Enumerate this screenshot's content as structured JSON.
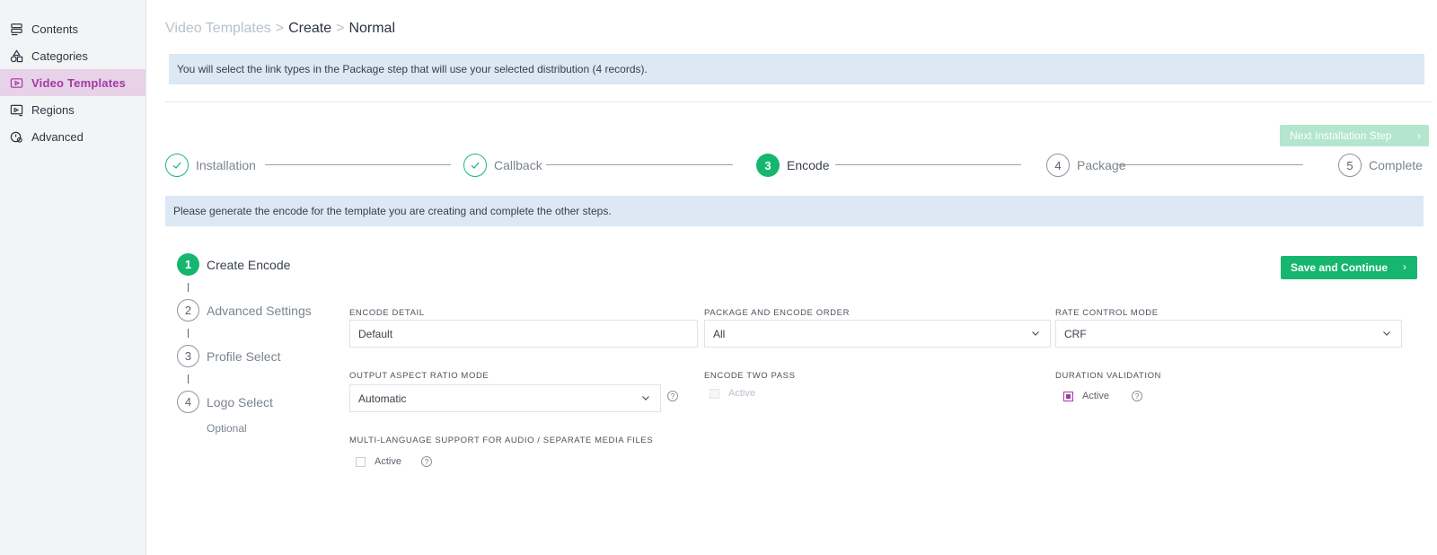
{
  "sidebar": {
    "items": [
      {
        "label": "Contents",
        "icon": "list-icon"
      },
      {
        "label": "Categories",
        "icon": "shapes-icon"
      },
      {
        "label": "Video Templates",
        "icon": "video-template-icon",
        "active": true
      },
      {
        "label": "Regions",
        "icon": "region-icon"
      },
      {
        "label": "Advanced",
        "icon": "advanced-icon"
      }
    ]
  },
  "breadcrumb": {
    "parent": "Video Templates",
    "sep": ">",
    "mid": "Create",
    "current": "Normal"
  },
  "info_banner": "You will select the link types in the Package step that will use your selected distribution (4 records).",
  "next_button": "Next Installation Step",
  "stepper": [
    {
      "num": "1",
      "label": "Installation",
      "state": "done"
    },
    {
      "num": "2",
      "label": "Callback",
      "state": "done"
    },
    {
      "num": "3",
      "label": "Encode",
      "state": "current"
    },
    {
      "num": "4",
      "label": "Package",
      "state": "pending"
    },
    {
      "num": "5",
      "label": "Complete",
      "state": "pending"
    }
  ],
  "encode_banner": "Please generate the encode for the template you are creating and complete the other steps.",
  "sub_steps": [
    {
      "num": "1",
      "label": "Create Encode",
      "state": "current"
    },
    {
      "num": "2",
      "label": "Advanced Settings",
      "state": "pending"
    },
    {
      "num": "3",
      "label": "Profile Select",
      "state": "pending"
    },
    {
      "num": "4",
      "label": "Logo Select",
      "state": "pending"
    }
  ],
  "optional_label": "Optional",
  "save_button": "Save and Continue",
  "form": {
    "encode_detail": {
      "label": "Encode Detail",
      "value": "Default"
    },
    "package_order": {
      "label": "Package and Encode Order",
      "value": "All"
    },
    "rate_control": {
      "label": "Rate Control Mode",
      "value": "CRF"
    },
    "aspect_ratio": {
      "label": "Output Aspect Ratio Mode",
      "value": "Automatic"
    },
    "two_pass": {
      "label": "Encode Two Pass",
      "check_label": "Active",
      "checked": false,
      "disabled": true
    },
    "duration_validation": {
      "label": "Duration Validation",
      "check_label": "Active",
      "checked": true
    },
    "multi_language": {
      "label": "Multi-Language Support for Audio / Separate Media Files",
      "check_label": "Active",
      "checked": false
    }
  },
  "colors": {
    "accent": "#a23aa6",
    "success": "#16b66f",
    "banner": "#dce8f3"
  }
}
